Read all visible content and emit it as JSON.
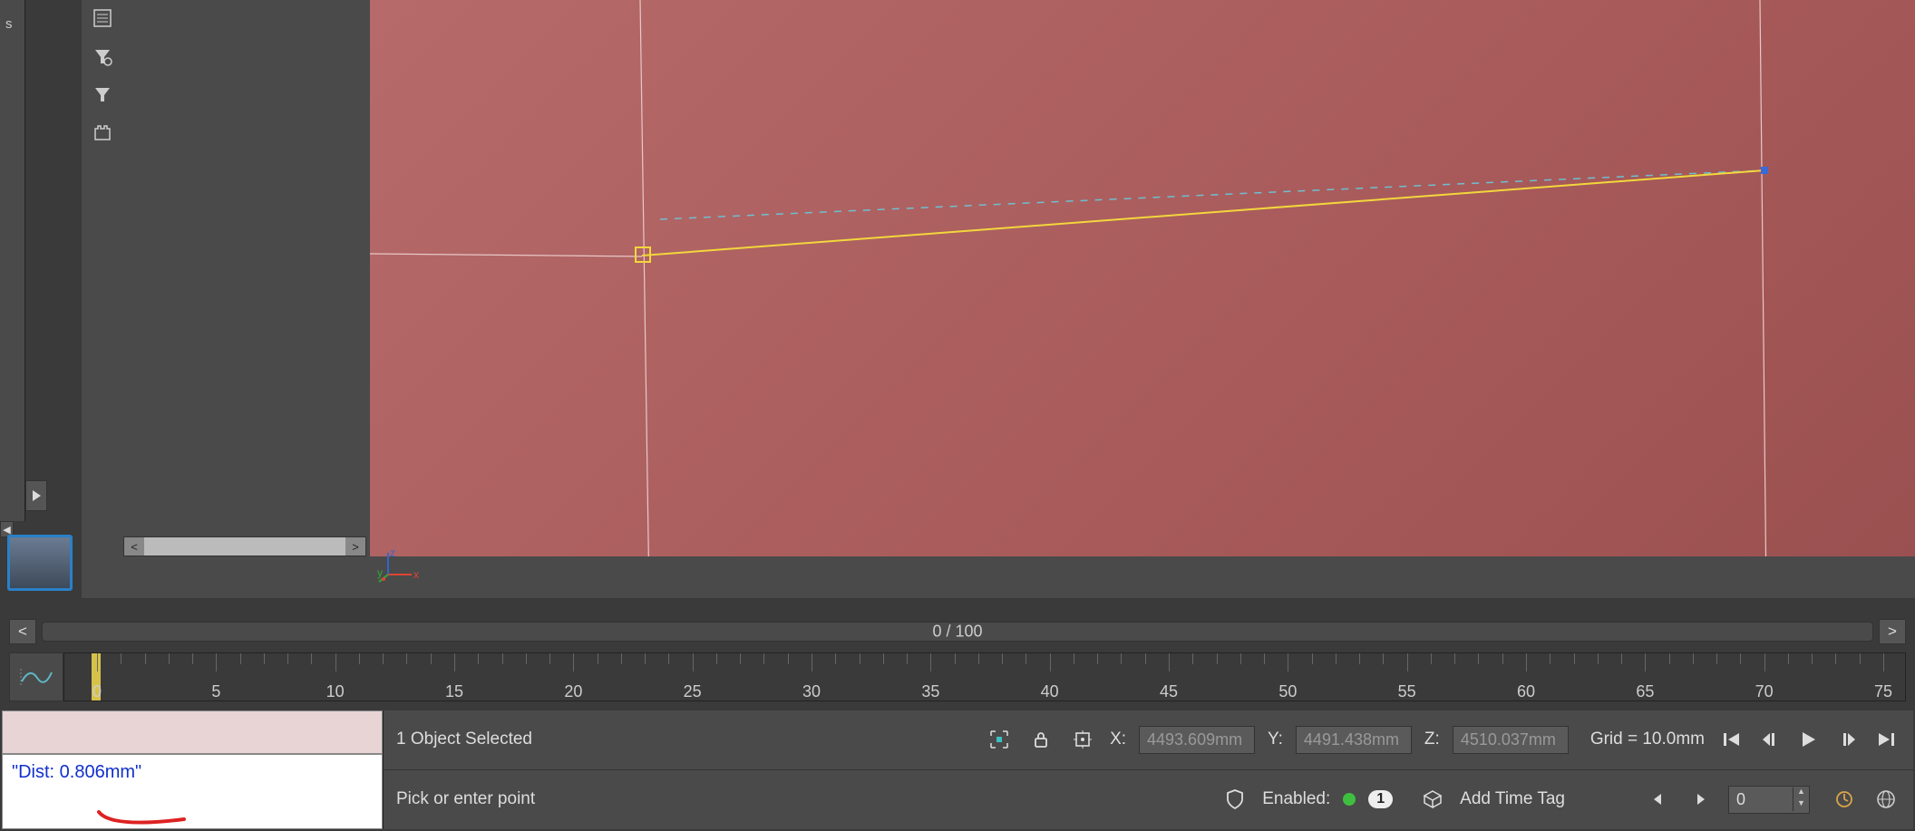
{
  "sidebar": {
    "letter": "s"
  },
  "frame": {
    "label": "0 / 100"
  },
  "timeline": {
    "ticks": [
      0,
      5,
      10,
      15,
      20,
      25,
      30,
      35,
      40,
      45,
      50,
      55,
      60,
      65,
      70,
      75
    ]
  },
  "listener": {
    "output": "\"Dist: 0.806mm\""
  },
  "status": {
    "selection": "1 Object Selected",
    "prompt": "Pick or enter point",
    "coords": {
      "x_label": "X:",
      "x_value": "4493.609mm",
      "y_label": "Y:",
      "y_value": "4491.438mm",
      "z_label": "Z:",
      "z_value": "4510.037mm"
    },
    "grid": "Grid = 10.0mm",
    "enabled_label": "Enabled:",
    "enabled_count": "1",
    "add_time_tag": "Add Time Tag",
    "frame_value": "0"
  }
}
